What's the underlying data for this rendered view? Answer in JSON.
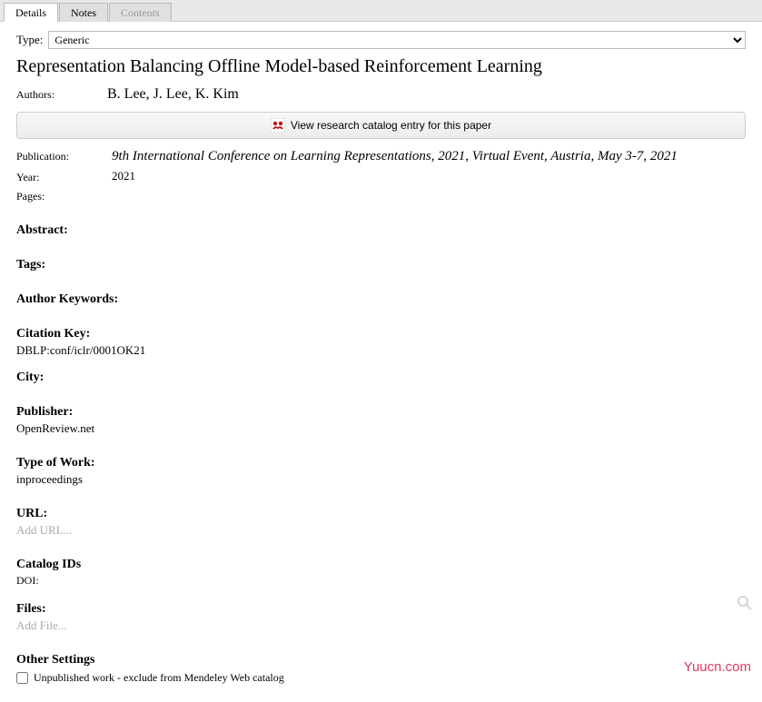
{
  "tabs": {
    "details": "Details",
    "notes": "Notes",
    "contents": "Contents"
  },
  "typeRow": {
    "label": "Type:",
    "value": "Generic"
  },
  "title": "Representation Balancing Offline Model-based Reinforcement Learning",
  "authorsLabel": "Authors:",
  "authors": "B. Lee, J. Lee, K. Kim",
  "catalogButton": "View research catalog entry for this paper",
  "publicationLabel": "Publication:",
  "publication": "9th International Conference on Learning Representations, 2021, Virtual Event, Austria, May 3-7, 2021",
  "yearLabel": "Year:",
  "year": "2021",
  "pagesLabel": "Pages:",
  "sections": {
    "abstract": "Abstract:",
    "tags": "Tags:",
    "authorKeywords": "Author Keywords:",
    "citationKey": "Citation Key:",
    "citationKeyValue": "DBLP:conf/iclr/0001OK21",
    "city": "City:",
    "publisher": "Publisher:",
    "publisherValue": "OpenReview.net",
    "typeOfWork": "Type of Work:",
    "typeOfWorkValue": "inproceedings",
    "url": "URL:",
    "urlPlaceholder": "Add URL...",
    "catalogIds": "Catalog IDs",
    "doi": "DOI:",
    "files": "Files:",
    "filesPlaceholder": "Add File...",
    "otherSettings": "Other Settings",
    "unpublished": "Unpublished work - exclude from Mendeley Web catalog"
  },
  "watermark": "Yuucn.com"
}
